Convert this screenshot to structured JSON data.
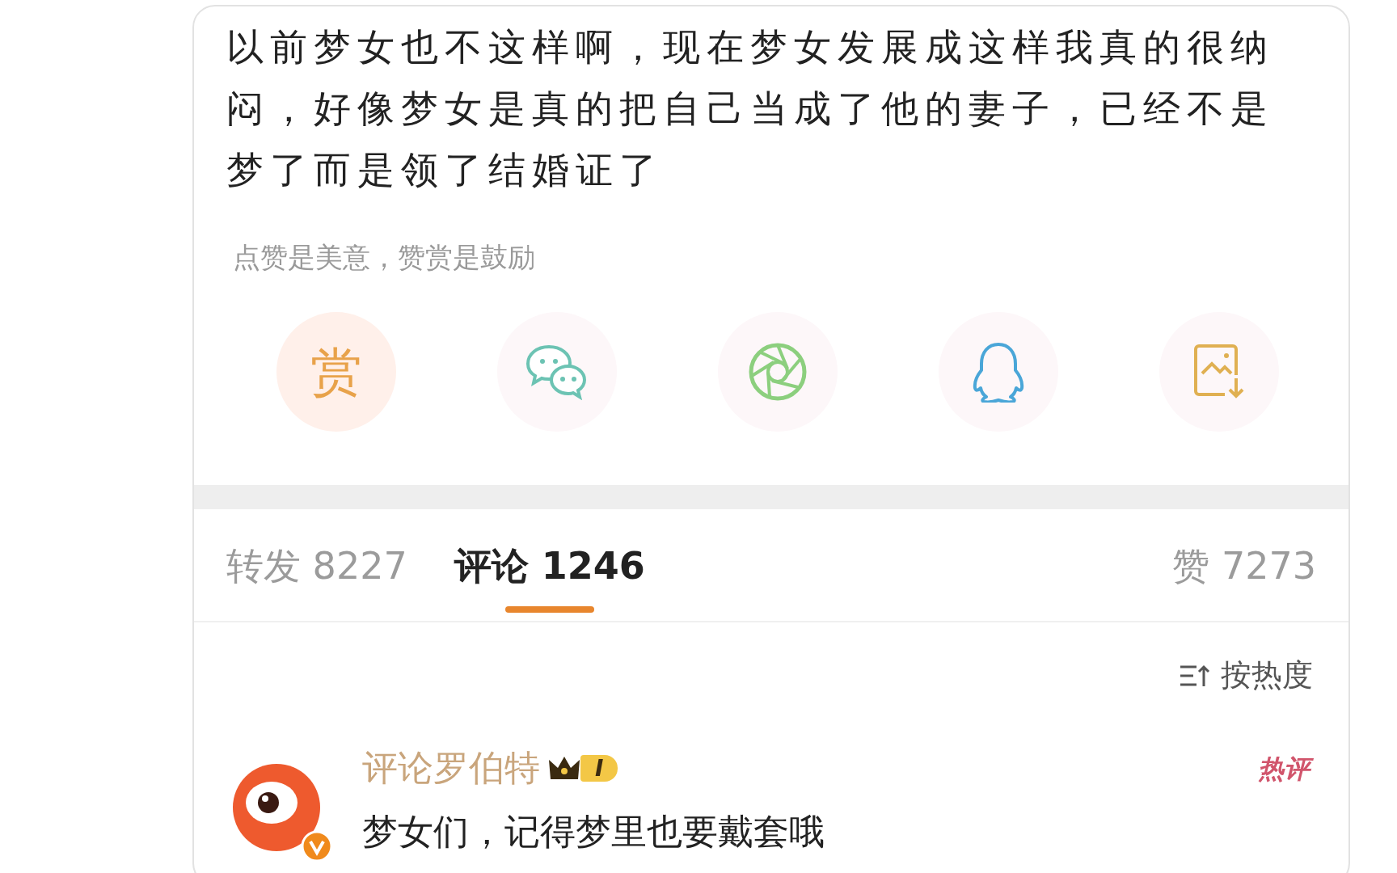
{
  "post": {
    "lines": [
      "以前梦女也不这样啊，现在梦女发展成这样我真的很纳",
      "闷，好像梦女是真的把自己当成了他的妻子，已经不是",
      "梦了而是领了结婚证了"
    ]
  },
  "reward_hint": "点赞是美意，赞赏是鼓励",
  "share_actions": [
    {
      "kind": "reward",
      "label": "赏"
    },
    {
      "kind": "wechat"
    },
    {
      "kind": "moments"
    },
    {
      "kind": "qq"
    },
    {
      "kind": "save-image"
    }
  ],
  "tabs": [
    {
      "label": "转发 8227",
      "selected": false
    },
    {
      "label": "评论 1246",
      "selected": true
    },
    {
      "label": "赞 7273",
      "selected": false
    }
  ],
  "sort": {
    "label": "按热度"
  },
  "comments": [
    {
      "user": "评论罗伯特",
      "level_badge": "I",
      "tag": "热评",
      "text": "梦女们，记得梦里也要戴套哦"
    }
  ]
}
